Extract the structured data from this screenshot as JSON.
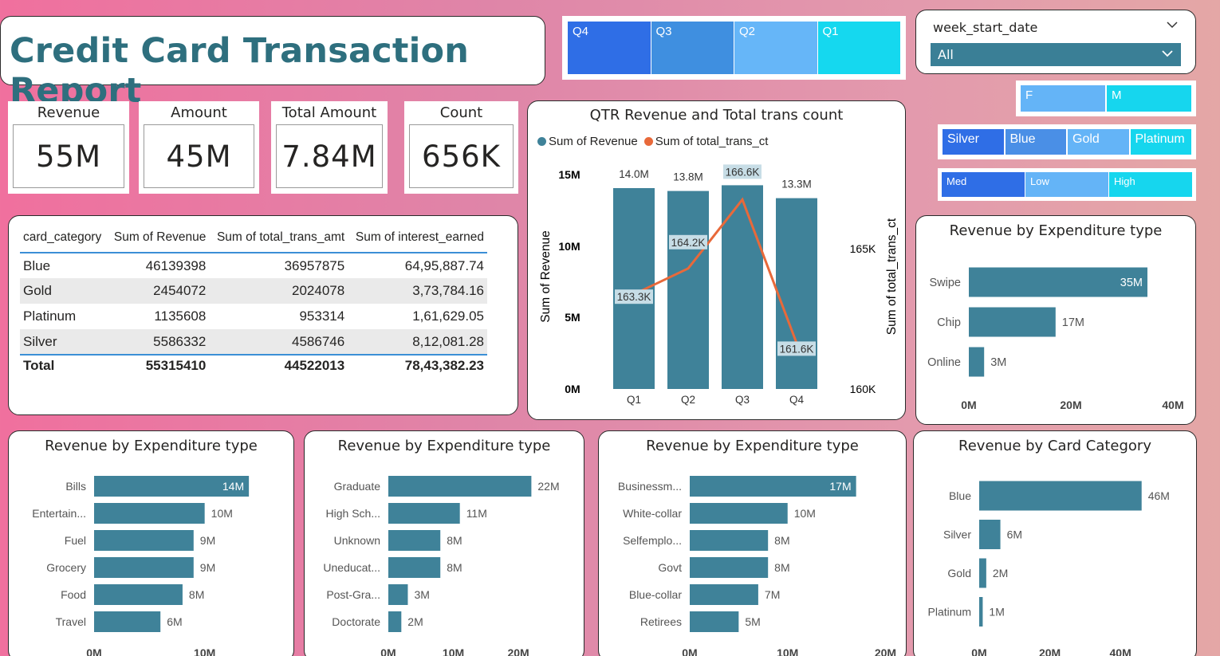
{
  "title": "Credit Card Transaction Report",
  "quarter_slicer": [
    "Q4",
    "Q3",
    "Q2",
    "Q1"
  ],
  "week_slicer": {
    "label": "week_start_date",
    "value": "All"
  },
  "gender_slicer": [
    "F",
    "M"
  ],
  "card_slicer": [
    "Silver",
    "Blue",
    "Gold",
    "Platinum"
  ],
  "interest_slicer": [
    "Med",
    "Low",
    "High"
  ],
  "kpis": [
    {
      "label": "Revenue",
      "value": "55M"
    },
    {
      "label": "Amount",
      "value": "45M"
    },
    {
      "label": "Total Amount",
      "value": "7.84M"
    },
    {
      "label": "Count",
      "value": "656K"
    }
  ],
  "table": {
    "headers": [
      "card_category",
      "Sum of Revenue",
      "Sum of total_trans_amt",
      "Sum of interest_earned"
    ],
    "rows": [
      [
        "Blue",
        "46139398",
        "36957875",
        "64,95,887.74"
      ],
      [
        "Gold",
        "2454072",
        "2024078",
        "3,73,784.16"
      ],
      [
        "Platinum",
        "1135608",
        "953314",
        "1,61,629.05"
      ],
      [
        "Silver",
        "5586332",
        "4586746",
        "8,12,081.28"
      ]
    ],
    "total": [
      "Total",
      "55315410",
      "44522013",
      "78,43,382.23"
    ]
  },
  "colors": {
    "bar": "#3f8299",
    "line": "#e8693a",
    "title_text": "#2e6f7e",
    "slicer_dark": "#2f6ee6",
    "slicer_mid": "#4a8fe6",
    "slicer_light": "#64b4f7",
    "slicer_cyan": "#16d6ee"
  },
  "combo_chart": {
    "title": "QTR Revenue and Total trans count",
    "legend": [
      "Sum of Revenue",
      "Sum of total_trans_ct"
    ],
    "ylabel_left": "Sum of Revenue",
    "ylabel_right": "Sum of total_trans_ct",
    "left_ticks": [
      "15M",
      "10M",
      "5M",
      "0M"
    ],
    "right_ticks": [
      "165K",
      "160K"
    ],
    "categories": [
      "Q1",
      "Q2",
      "Q3",
      "Q4"
    ],
    "revenue_labels": [
      "14.0M",
      "13.8M",
      "14.2M",
      "13.3M"
    ],
    "count_labels": [
      "163.3K",
      "164.2K",
      "166.6K",
      "161.6K"
    ]
  },
  "chart_data": [
    {
      "type": "bar",
      "title": "QTR Revenue and Total trans count",
      "categories": [
        "Q1",
        "Q2",
        "Q3",
        "Q4"
      ],
      "series": [
        {
          "name": "Sum of Revenue",
          "values": [
            14.0,
            13.8,
            14.2,
            13.3
          ],
          "unit": "M"
        },
        {
          "name": "Sum of total_trans_ct",
          "values": [
            163.3,
            164.2,
            166.6,
            161.6
          ],
          "unit": "K",
          "type": "line"
        }
      ],
      "ylim": [
        0,
        15
      ],
      "ylim_right": [
        160,
        167.5
      ]
    },
    {
      "type": "bar",
      "orientation": "horizontal",
      "title": "Revenue by Expenditure type",
      "categories": [
        "Swipe",
        "Chip",
        "Online"
      ],
      "values": [
        35,
        17,
        3
      ],
      "labels": [
        "35M",
        "17M",
        "3M"
      ],
      "xticks": [
        "0M",
        "20M",
        "40M"
      ],
      "xlim": [
        0,
        40
      ]
    },
    {
      "type": "bar",
      "orientation": "horizontal",
      "title": "Revenue by Expenditure type",
      "categories": [
        "Bills",
        "Entertain...",
        "Fuel",
        "Grocery",
        "Food",
        "Travel"
      ],
      "values": [
        14,
        10,
        9,
        9,
        8,
        6
      ],
      "labels": [
        "14M",
        "10M",
        "9M",
        "9M",
        "8M",
        "6M"
      ],
      "xticks": [
        "0M",
        "10M"
      ],
      "xlim": [
        0,
        15
      ]
    },
    {
      "type": "bar",
      "orientation": "horizontal",
      "title": "Revenue by Expenditure type",
      "categories": [
        "Graduate",
        "High Sch...",
        "Unknown",
        "Uneducat...",
        "Post-Gra...",
        "Doctorate"
      ],
      "values": [
        22,
        11,
        8,
        8,
        3,
        2
      ],
      "labels": [
        "22M",
        "11M",
        "8M",
        "8M",
        "3M",
        "2M"
      ],
      "xticks": [
        "0M",
        "10M",
        "20M"
      ],
      "xlim": [
        0,
        26
      ]
    },
    {
      "type": "bar",
      "orientation": "horizontal",
      "title": "Revenue by Expenditure type",
      "categories": [
        "Businessm...",
        "White-collar",
        "Selfemplo...",
        "Govt",
        "Blue-collar",
        "Retirees"
      ],
      "values": [
        17,
        10,
        8,
        8,
        7,
        5
      ],
      "labels": [
        "17M",
        "10M",
        "8M",
        "8M",
        "7M",
        "5M"
      ],
      "xticks": [
        "0M",
        "10M",
        "20M"
      ],
      "xlim": [
        0,
        22
      ]
    },
    {
      "type": "bar",
      "orientation": "horizontal",
      "title": "Revenue by Card Category",
      "categories": [
        "Blue",
        "Silver",
        "Gold",
        "Platinum"
      ],
      "values": [
        46,
        6,
        2,
        1
      ],
      "labels": [
        "46M",
        "6M",
        "2M",
        "1M"
      ],
      "xticks": [
        "0M",
        "20M",
        "40M"
      ],
      "xlim": [
        0,
        56
      ]
    }
  ]
}
